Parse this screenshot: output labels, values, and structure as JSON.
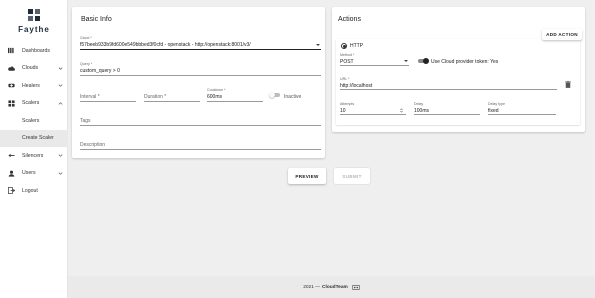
{
  "app": {
    "name": "Faythe"
  },
  "sidebar": {
    "items": [
      {
        "label": "Dashboards",
        "icon": "dashboard-icon"
      },
      {
        "label": "Clouds",
        "icon": "cloud-icon"
      },
      {
        "label": "Healers",
        "icon": "healer-icon"
      },
      {
        "label": "Scalers",
        "icon": "scaler-icon"
      },
      {
        "label": "Silencers",
        "icon": "silencer-icon"
      },
      {
        "label": "Users",
        "icon": "user-icon"
      },
      {
        "label": "Logout",
        "icon": "logout-icon"
      }
    ],
    "scalers_sub": [
      {
        "label": "Scalers"
      },
      {
        "label": "Create Scaler"
      }
    ]
  },
  "basic_info": {
    "title": "Basic Info",
    "cloud": {
      "label": "Cloud *",
      "value": "f57beeb933b9fd600e549bbbed3f0cfd - openstack - http://openstack:8001/v3/"
    },
    "query": {
      "label": "Query *",
      "value": "custom_query > 0"
    },
    "interval": {
      "placeholder": "Interval *"
    },
    "duration": {
      "placeholder": "Duration *"
    },
    "cooldown": {
      "label": "Cooldown *",
      "value": "600ms"
    },
    "active": {
      "label": "Inactive"
    },
    "tags": {
      "placeholder": "Tags"
    },
    "description": {
      "placeholder": "Description"
    }
  },
  "actions": {
    "title": "Actions",
    "add_action_label": "ADD ACTION",
    "type": {
      "label": "HTTP"
    },
    "method": {
      "label": "Method *",
      "value": "POST"
    },
    "cloud_token": {
      "label": "Use Cloud provider token: Yes"
    },
    "url": {
      "label": "URL *",
      "value": "http://localhost"
    },
    "attempts": {
      "label": "Attempts",
      "value": "10"
    },
    "delay": {
      "label": "Delay",
      "value": "100ms"
    },
    "delay_type": {
      "label": "Delay type",
      "value": "fixed"
    }
  },
  "buttons": {
    "preview": "PREVIEW",
    "submit": "SUBMIT"
  },
  "footer": {
    "year": "2021 —",
    "brand": "CloudTeam"
  },
  "colors": {
    "accent": "#1f2b3a",
    "background": "#efefef",
    "sidebar_active": "#e9e9e9"
  }
}
